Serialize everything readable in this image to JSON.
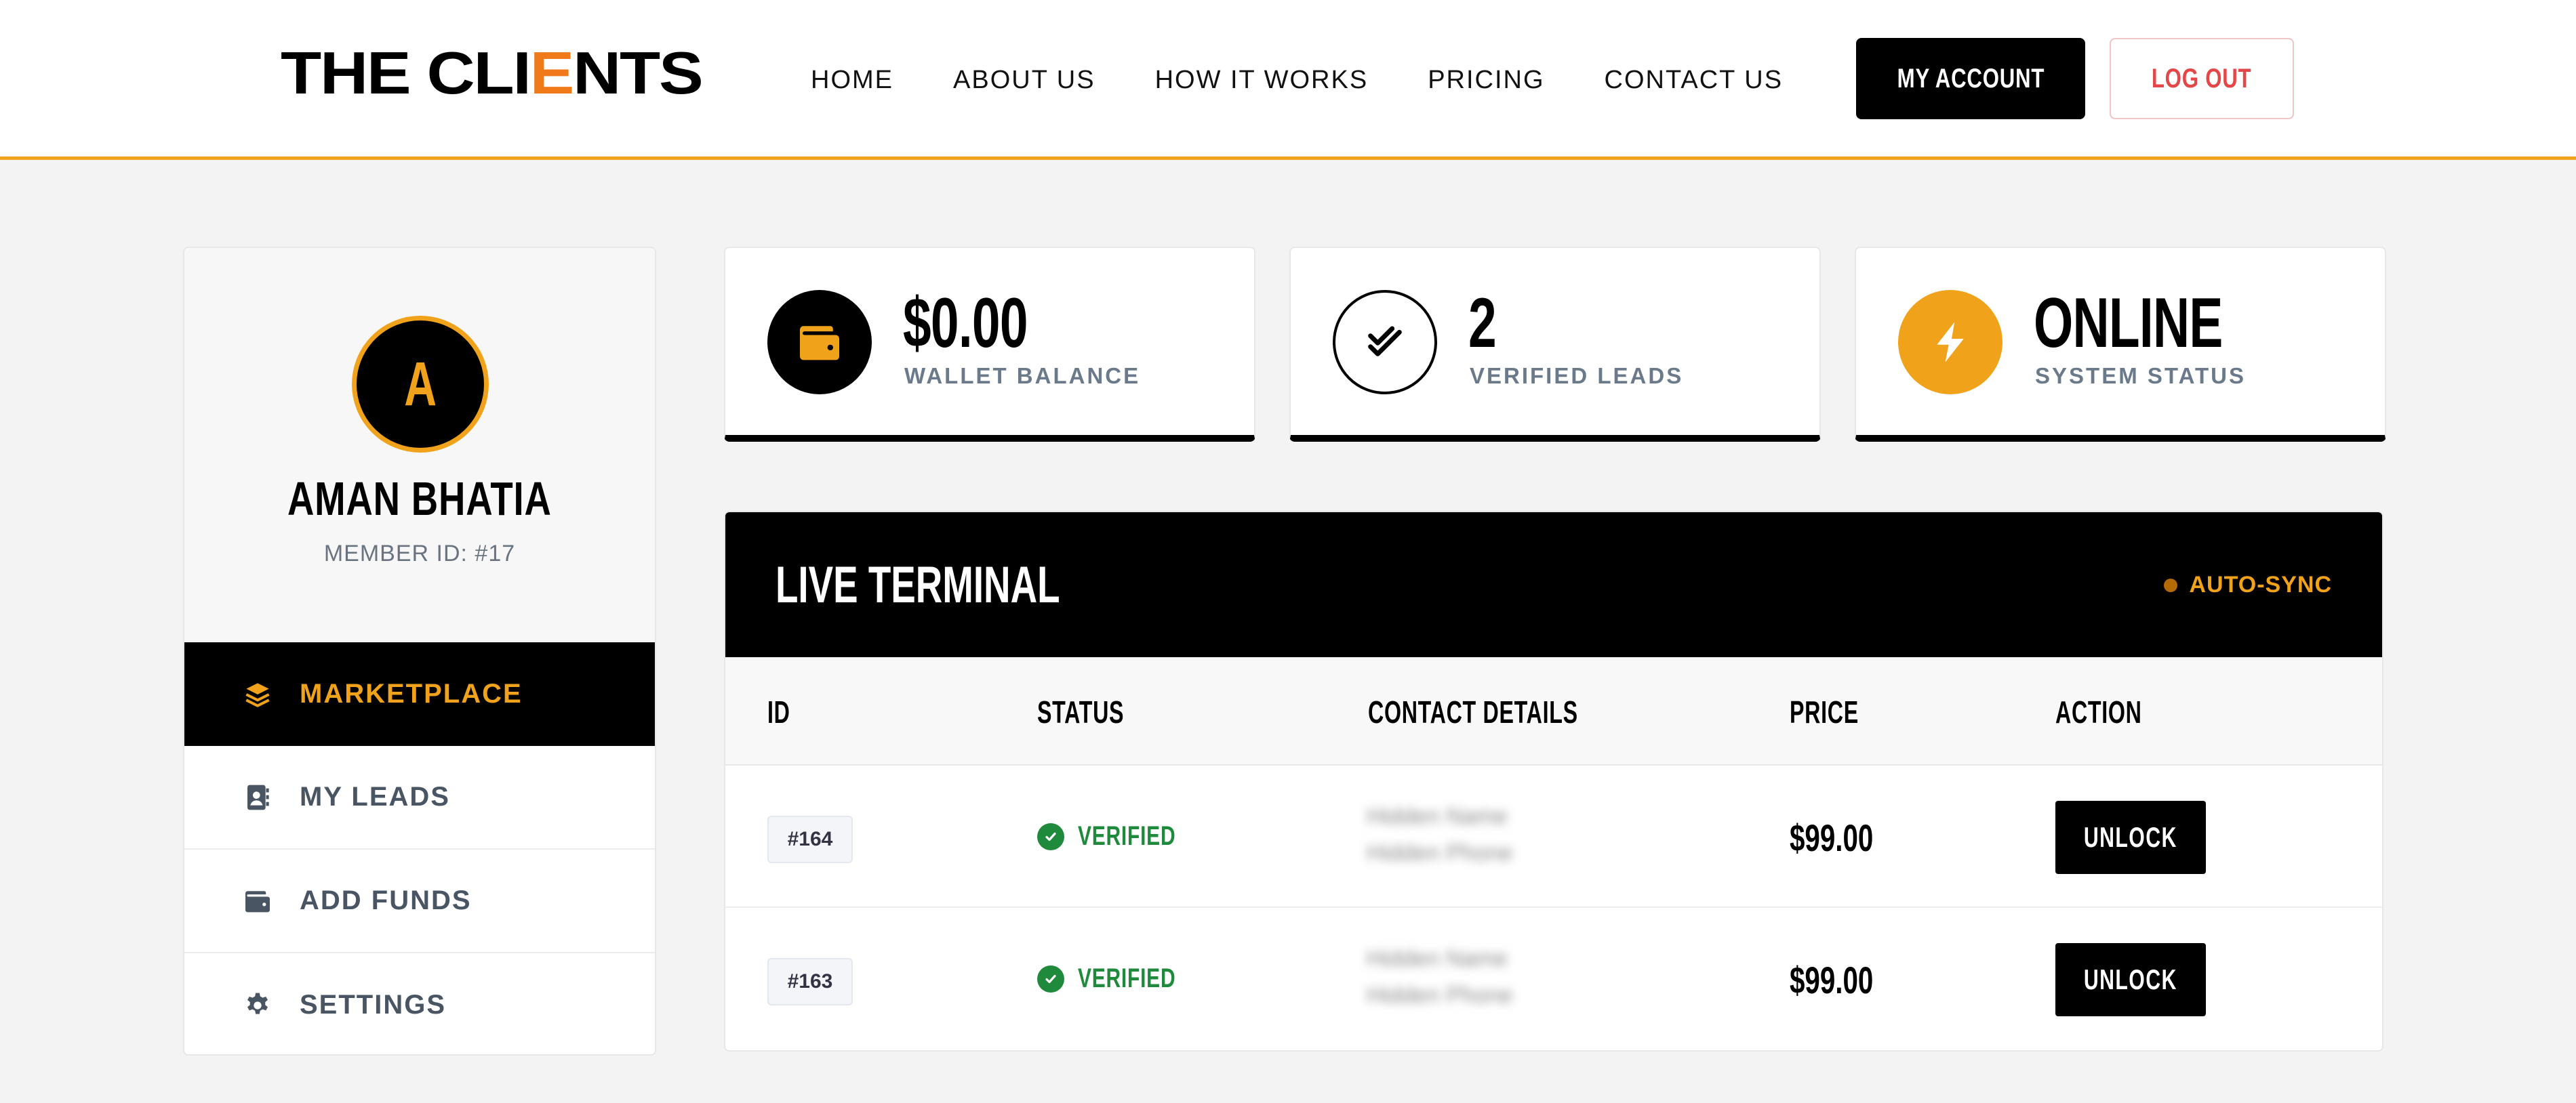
{
  "header": {
    "logo": {
      "part1": "THE CLI",
      "part2": "E",
      "part3": "NTS"
    },
    "nav": [
      "HOME",
      "ABOUT US",
      "HOW IT WORKS",
      "PRICING",
      "CONTACT US"
    ],
    "account_label": "MY ACCOUNT",
    "logout_label": "LOG OUT"
  },
  "profile": {
    "avatar_initial": "A",
    "name": "AMAN BHATIA",
    "member_id": "MEMBER ID: #17"
  },
  "sidebar": {
    "items": [
      {
        "label": "MARKETPLACE",
        "icon": "layers-icon",
        "active": true
      },
      {
        "label": "MY LEADS",
        "icon": "contact-book-icon",
        "active": false
      },
      {
        "label": "ADD FUNDS",
        "icon": "wallet-icon",
        "active": false
      },
      {
        "label": "SETTINGS",
        "icon": "gear-icon",
        "active": false
      }
    ]
  },
  "stats": [
    {
      "value": "$0.00",
      "label": "WALLET BALANCE",
      "icon": "wallet-icon"
    },
    {
      "value": "2",
      "label": "VERIFIED LEADS",
      "icon": "double-check-icon"
    },
    {
      "value": "ONLINE",
      "label": "SYSTEM STATUS",
      "icon": "bolt-icon"
    }
  ],
  "terminal": {
    "title": "LIVE TERMINAL",
    "sync_label": "AUTO-SYNC",
    "columns": [
      "ID",
      "STATUS",
      "CONTACT DETAILS",
      "PRICE",
      "ACTION"
    ],
    "rows": [
      {
        "id": "#164",
        "status": "VERIFIED",
        "contact_line1": "Hidden Name",
        "contact_line2": "Hidden Phone",
        "price": "$99.00",
        "action": "UNLOCK"
      },
      {
        "id": "#163",
        "status": "VERIFIED",
        "contact_line1": "Hidden Name",
        "contact_line2": "Hidden Phone",
        "price": "$99.00",
        "action": "UNLOCK"
      }
    ]
  },
  "colors": {
    "accent": "#f0a21a",
    "logo_accent": "#f07a1a",
    "verified": "#1f8a3c",
    "logout": "#e34747"
  }
}
